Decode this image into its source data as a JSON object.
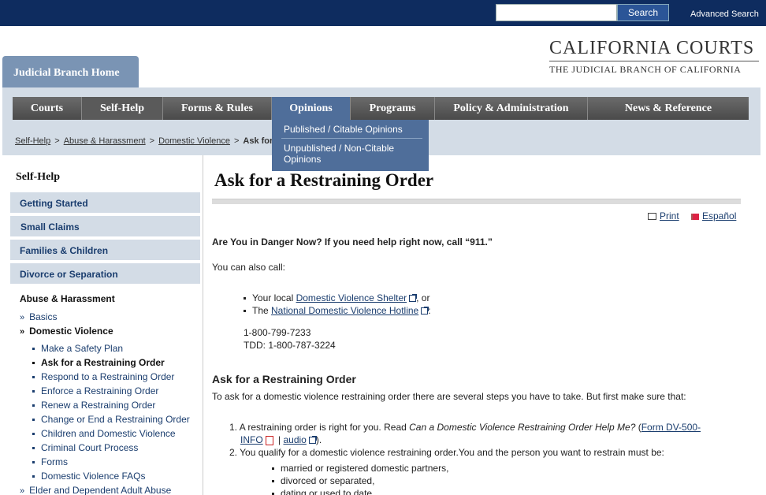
{
  "topbar": {
    "search_placeholder": "",
    "search_button": "Search",
    "advanced_search": "Advanced Search"
  },
  "header": {
    "home_tab": "Judicial Branch Home",
    "logo_title": "CALIFORNIA COURTS",
    "logo_subtitle": "THE JUDICIAL BRANCH OF CALIFORNIA"
  },
  "nav": {
    "items": [
      {
        "label": "Courts"
      },
      {
        "label": "Self-Help"
      },
      {
        "label": "Forms & Rules"
      },
      {
        "label": "Opinions"
      },
      {
        "label": "Programs"
      },
      {
        "label": "Policy & Administration"
      },
      {
        "label": "News & Reference"
      }
    ],
    "dropdown": [
      "Published / Citable Opinions",
      "Unpublished / Non-Citable Opinions"
    ]
  },
  "breadcrumb": {
    "items": [
      "Self-Help",
      "Abuse & Harassment",
      "Domestic Violence"
    ],
    "separator": ">",
    "current": "Ask for"
  },
  "sidebar": {
    "title": "Self-Help",
    "buttons": [
      "Getting Started",
      "Small Claims",
      "Families & Children",
      "Divorce or Separation"
    ],
    "section": "Abuse & Harassment",
    "links": [
      {
        "label": "Basics",
        "marker": "»"
      },
      {
        "label": "Domestic Violence",
        "marker": "»"
      }
    ],
    "sub_links": [
      "Make a Safety Plan",
      "Ask for a Restraining Order",
      "Respond to a Restraining Order",
      "Enforce a Restraining Order",
      "Renew a Restraining Order",
      "Change or End a Restraining Order",
      "Children and Domestic Violence",
      "Criminal Court Process",
      "Forms",
      "Domestic Violence FAQs"
    ],
    "last_link": {
      "label": "Elder and Dependent Adult Abuse",
      "marker": "»"
    }
  },
  "main": {
    "title": "Ask for a Restraining Order",
    "print": "Print",
    "espanol": "Español",
    "danger": "Are You in Danger Now? If you need help right now, call “911.”",
    "also_call": "You can also call:",
    "bullet1_pre": "Your local ",
    "bullet1_link": "Domestic Violence Shelter",
    "bullet1_post": ", or",
    "bullet2_pre": "The ",
    "bullet2_link": "National Domestic Violence Hotline",
    "bullet2_post": ":",
    "phone": "1-800-799-7233",
    "tdd": "TDD: 1-800-787-3224",
    "section_heading": "Ask for a Restraining Order",
    "intro": "To ask for a domestic violence restraining order there are several steps you have to take. But first make sure that:",
    "step1_pre": "A restraining order is right for you. Read ",
    "step1_italic": "Can a Domestic Violence Restraining Order Help Me?",
    "step1_paren": " (",
    "step1_form_a": "Form DV-500-",
    "step1_form_b": "INFO",
    "step1_bar": " | ",
    "step1_audio": "audio",
    "step1_end": ").",
    "step2": "You qualify for a domestic violence restraining order.You and the person you want to restrain must be:",
    "qualify": [
      "married or registered domestic partners,",
      "divorced or separated,",
      "dating or used to date"
    ]
  }
}
